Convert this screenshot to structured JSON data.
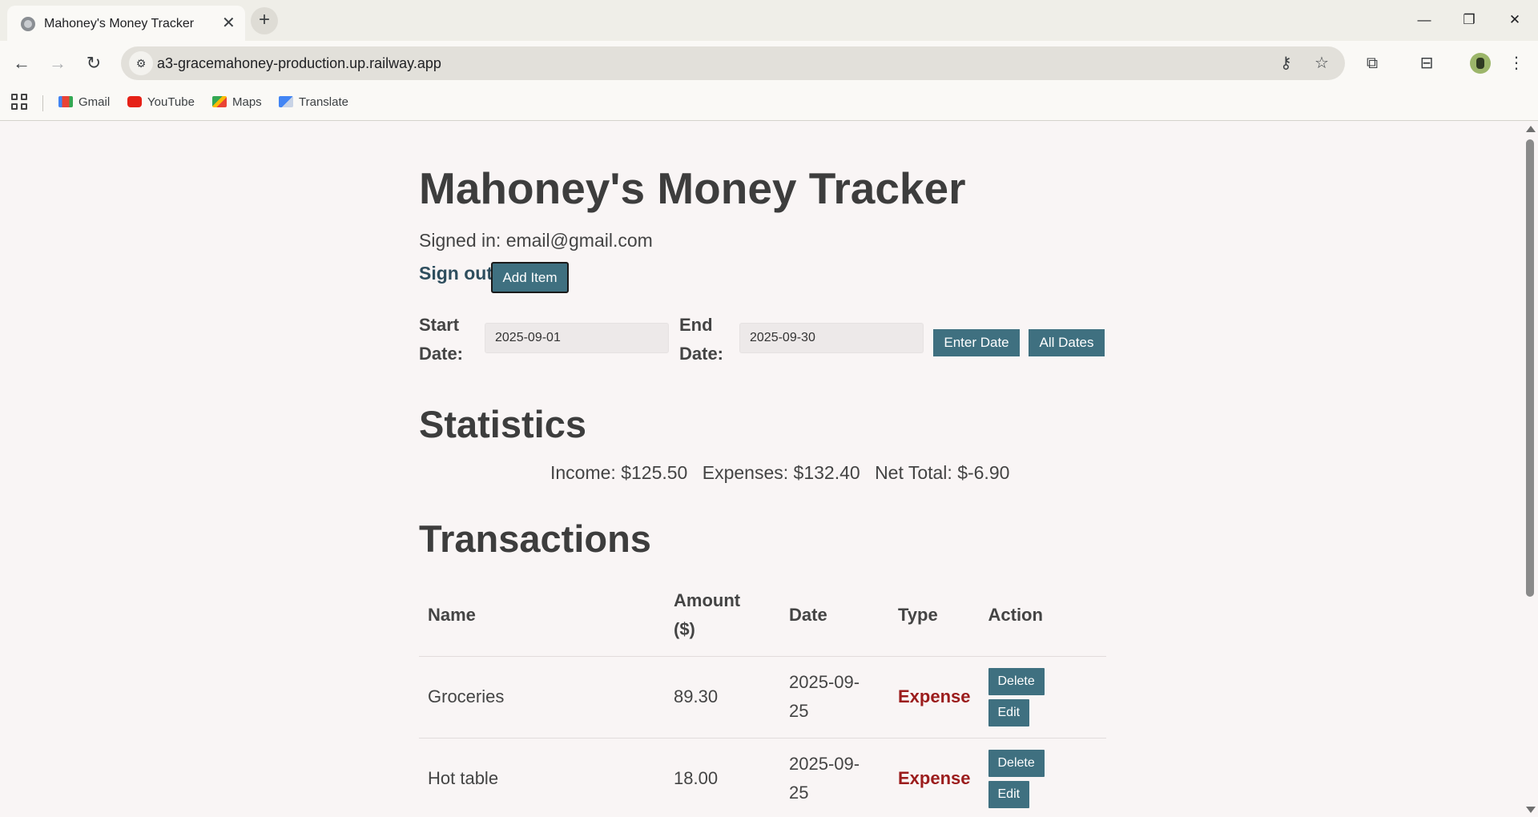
{
  "browser": {
    "tab_title": "Mahoney's Money Tracker",
    "tab_close": "✕",
    "new_tab": "+",
    "url": "a3-gracemahoney-production.up.railway.app",
    "bookmarks": [
      "Gmail",
      "YouTube",
      "Maps",
      "Translate"
    ],
    "icons": {
      "back": "back-arrow-icon",
      "forward": "forward-arrow-icon",
      "reload": "reload-icon",
      "password": "key-icon",
      "bookmark": "star-icon",
      "extensions": "puzzle-icon",
      "search_tab": "tab-search-icon",
      "menu": "kebab-menu-icon"
    }
  },
  "app": {
    "title": "Mahoney's Money Tracker",
    "signed_in": "Signed in: email@gmail.com",
    "sign_out": "Sign out",
    "add_item": "Add Item",
    "filters": {
      "start_label_1": "Start",
      "start_label_2": "Date:",
      "start_value": "2025-09-01",
      "end_label_1": "End",
      "end_label_2": "Date:",
      "end_value": "2025-09-30",
      "enter_date": "Enter Date",
      "all_dates": "All Dates"
    },
    "statistics": {
      "heading": "Statistics",
      "income": "Income: $125.50",
      "expenses": "Expenses: $132.40",
      "net_total": "Net Total: $-6.90"
    },
    "transactions": {
      "heading": "Transactions",
      "columns": {
        "name": "Name",
        "amount_1": "Amount",
        "amount_2": "($)",
        "date": "Date",
        "type": "Type",
        "action": "Action"
      },
      "rows": [
        {
          "name": "Groceries",
          "amount": "89.30",
          "date_1": "2025-09-",
          "date_2": "25",
          "type": "Expense",
          "delete": "Delete",
          "edit": "Edit"
        },
        {
          "name": "Hot table",
          "amount": "18.00",
          "date_1": "2025-09-",
          "date_2": "25",
          "type": "Expense",
          "delete": "Delete",
          "edit": "Edit"
        }
      ]
    }
  },
  "colors": {
    "button": "#3f7080",
    "expense": "#9b1c1c",
    "page_bg": "#f9f5f5",
    "text": "#3d3d3d"
  }
}
